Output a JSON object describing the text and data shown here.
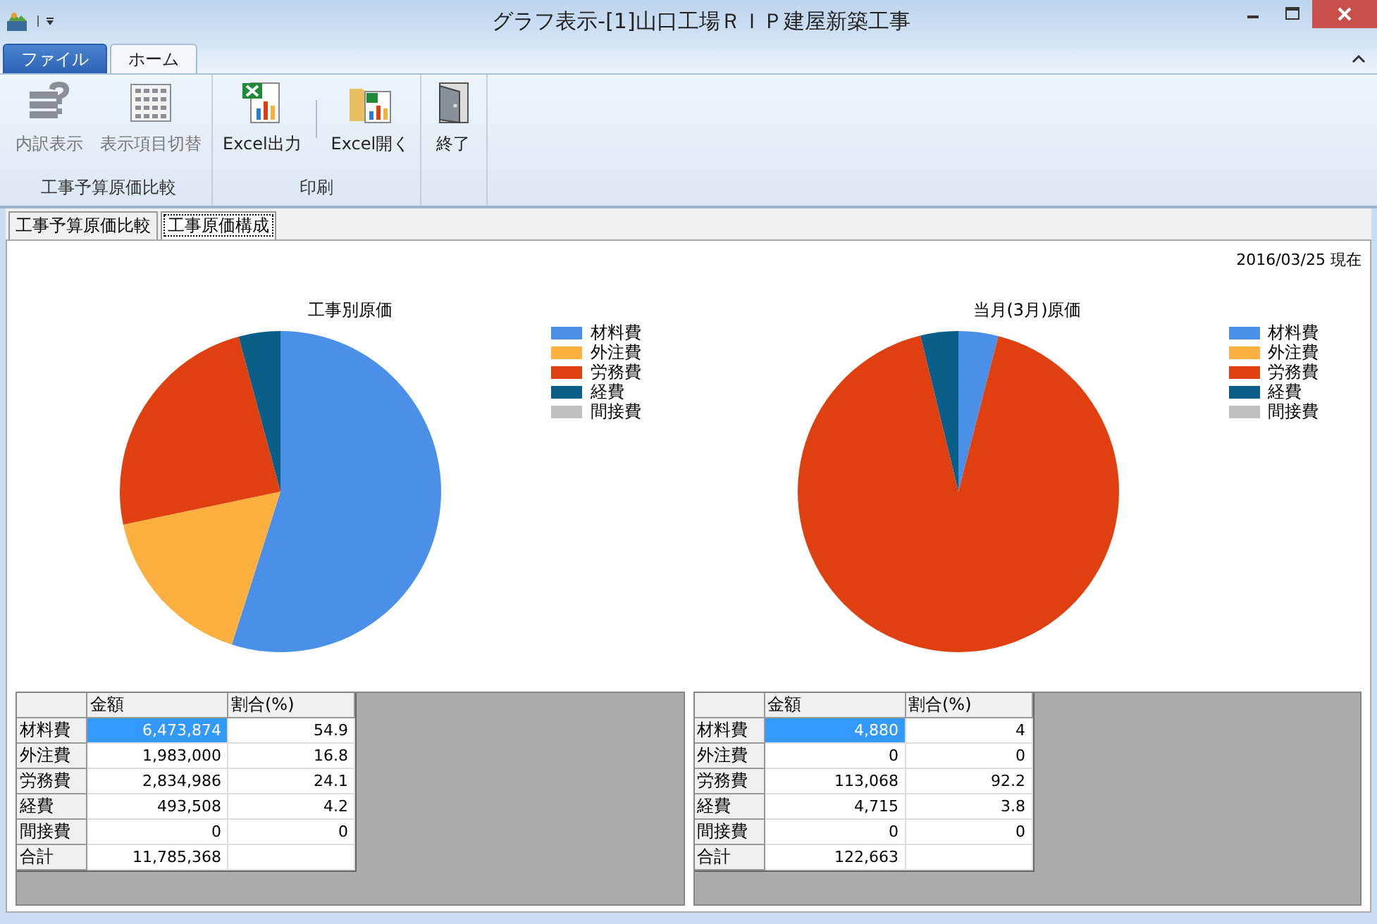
{
  "window": {
    "title": "グラフ表示-[1]山口工場ＲＩＰ建屋新築工事"
  },
  "file_menu": {
    "label": "ファイル"
  },
  "ribbon_tabs": [
    {
      "label": "ホーム",
      "selected": true
    }
  ],
  "ribbon_groups": [
    {
      "label": "工事予算原価比較",
      "buttons": [
        {
          "label": "内訳表示",
          "kind": "help-list",
          "disabled": true
        },
        {
          "label": "表示項目切替",
          "kind": "grid",
          "disabled": true
        }
      ]
    },
    {
      "label": "印刷",
      "buttons": [
        {
          "label": "Excel出力",
          "kind": "excel-export",
          "disabled": false
        },
        {
          "label": "Excel開く",
          "kind": "excel-open",
          "disabled": false
        }
      ]
    },
    {
      "buttons": [
        {
          "label": "終了",
          "kind": "exit",
          "disabled": false
        }
      ]
    }
  ],
  "view_tabs": [
    {
      "label": "工事予算原価比較",
      "selected": false
    },
    {
      "label": "工事原価構成",
      "selected": true
    }
  ],
  "as_of": "2016/03/25 現在",
  "panels": [
    {
      "chart_data": {
        "type": "pie",
        "title": "工事別原価",
        "categories": [
          "材料費",
          "外注費",
          "労務費",
          "経費",
          "間接費"
        ],
        "values": [
          54.9,
          16.8,
          24.1,
          4.2,
          0
        ],
        "colors": [
          "#4a90e8",
          "#fbb040",
          "#e04010",
          "#0a5f8a",
          "#c0c0c0"
        ]
      },
      "table": {
        "columns": [
          "金額",
          "割合(%)"
        ],
        "rows": [
          {
            "label": "材料費",
            "amount": "6,473,874",
            "ratio": "54.9",
            "selected": true
          },
          {
            "label": "外注費",
            "amount": "1,983,000",
            "ratio": "16.8",
            "selected": false
          },
          {
            "label": "労務費",
            "amount": "2,834,986",
            "ratio": "24.1",
            "selected": false
          },
          {
            "label": "経費",
            "amount": "493,508",
            "ratio": "4.2",
            "selected": false
          },
          {
            "label": "間接費",
            "amount": "0",
            "ratio": "0",
            "selected": false
          },
          {
            "label": "合計",
            "amount": "11,785,368",
            "selected": false
          }
        ]
      }
    },
    {
      "chart_data": {
        "type": "pie",
        "title": "当月(3月)原価",
        "categories": [
          "材料費",
          "外注費",
          "労務費",
          "経費",
          "間接費"
        ],
        "values": [
          4,
          0,
          92.2,
          3.8,
          0
        ],
        "colors": [
          "#4a90e8",
          "#fbb040",
          "#e04010",
          "#0a5f8a",
          "#c0c0c0"
        ]
      },
      "table": {
        "columns": [
          "金額",
          "割合(%)"
        ],
        "rows": [
          {
            "label": "材料費",
            "amount": "4,880",
            "ratio": "4",
            "selected": true
          },
          {
            "label": "外注費",
            "amount": "0",
            "ratio": "0",
            "selected": false
          },
          {
            "label": "労務費",
            "amount": "113,068",
            "ratio": "92.2",
            "selected": false
          },
          {
            "label": "経費",
            "amount": "4,715",
            "ratio": "3.8",
            "selected": false
          },
          {
            "label": "間接費",
            "amount": "0",
            "ratio": "0",
            "selected": false
          },
          {
            "label": "合計",
            "amount": "122,663",
            "selected": false
          }
        ]
      }
    }
  ]
}
